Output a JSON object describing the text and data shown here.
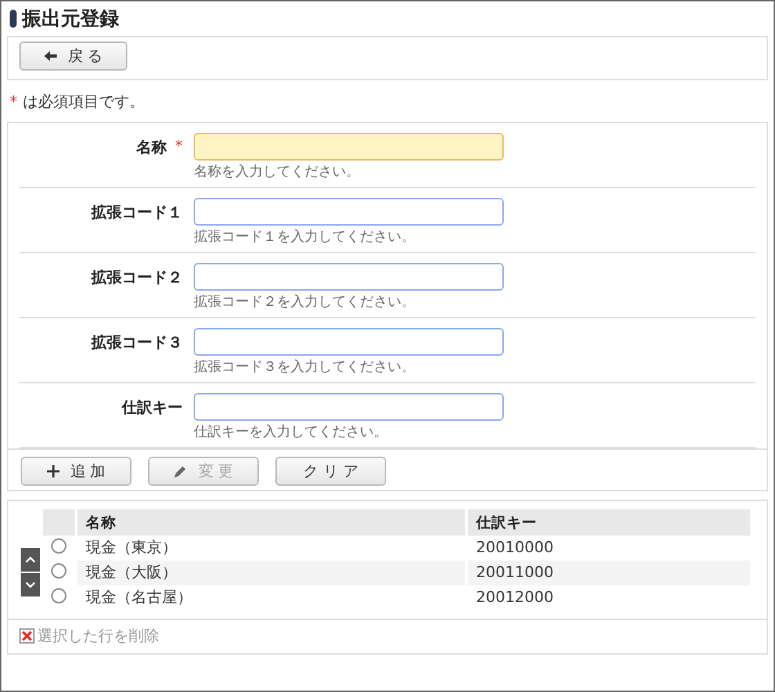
{
  "title": "振出元登録",
  "back_button": {
    "label": "戻 る"
  },
  "required_note": {
    "mark": "*",
    "text": "は必須項目です。"
  },
  "fields": [
    {
      "label": "名称",
      "required": true,
      "hint": "名称を入力してください。"
    },
    {
      "label": "拡張コード１",
      "required": false,
      "hint": "拡張コード１を入力してください。"
    },
    {
      "label": "拡張コード２",
      "required": false,
      "hint": "拡張コード２を入力してください。"
    },
    {
      "label": "拡張コード３",
      "required": false,
      "hint": "拡張コード３を入力してください。"
    },
    {
      "label": "仕訳キー",
      "required": false,
      "hint": "仕訳キーを入力してください。"
    }
  ],
  "buttons": [
    {
      "kind": "add",
      "label": "追 加",
      "disabled": false
    },
    {
      "kind": "edit",
      "label": "変 更",
      "disabled": true
    },
    {
      "kind": "clear",
      "label": "ク リ ア",
      "disabled": false
    }
  ],
  "table": {
    "columns": [
      "名称",
      "仕訳キー"
    ],
    "rows": [
      {
        "cells": [
          "現金（東京）",
          "20010000"
        ],
        "selected": false
      },
      {
        "cells": [
          "現金（大阪）",
          "20011000"
        ],
        "selected": false
      },
      {
        "cells": [
          "現金（名古屋）",
          "20012000"
        ],
        "selected": false
      }
    ]
  },
  "delete_link": {
    "label": "選択した行を削除"
  }
}
